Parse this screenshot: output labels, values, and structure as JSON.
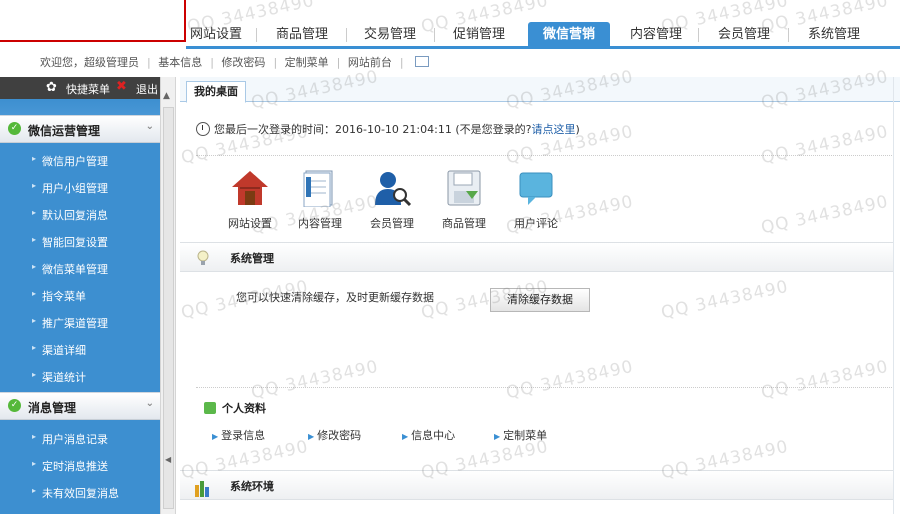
{
  "nav": {
    "tabs": [
      "网站设置",
      "商品管理",
      "交易管理",
      "促销管理",
      "微信营销",
      "内容管理",
      "会员管理",
      "系统管理"
    ],
    "active_index": 4
  },
  "user_bar": {
    "welcome": "欢迎您，超级管理员",
    "links": [
      "基本信息",
      "修改密码",
      "定制菜单",
      "网站前台"
    ]
  },
  "sidebar": {
    "toolbar": {
      "quick_menu": "快捷菜单",
      "exit": "退出"
    },
    "groups": [
      {
        "title": "微信运营管理",
        "items": [
          "微信用户管理",
          "用户小组管理",
          "默认回复消息",
          "智能回复设置",
          "微信菜单管理",
          "指令菜单",
          "推广渠道管理",
          "渠道详细",
          "渠道统计"
        ]
      },
      {
        "title": "消息管理",
        "items": [
          "用户消息记录",
          "定时消息推送",
          "未有效回复消息"
        ]
      }
    ]
  },
  "main": {
    "tab_label": "我的桌面",
    "login_info": {
      "prefix": "您最后一次登录的时间：",
      "time": "2016-10-10 21:04:11",
      "question": "(不是您登录的?",
      "link": "请点这里",
      "close_paren": ")"
    },
    "quick_icons": [
      "网站设置",
      "内容管理",
      "会员管理",
      "商品管理",
      "用户评论"
    ],
    "system_section": {
      "title": "系统管理",
      "cache_text": "您可以快速清除缓存，及时更新缓存数据",
      "cache_button": "清除缓存数据"
    },
    "profile_section": {
      "title": "个人资料",
      "links": [
        "登录信息",
        "修改密码",
        "信息中心",
        "定制菜单"
      ]
    },
    "env_section": {
      "title": "系统环境"
    }
  },
  "watermark": {
    "text": "QQ 34438490"
  },
  "colors": {
    "accent": "#3a8fd3",
    "sidebar_bg": "#3d8fd0",
    "link": "#1f5fa8",
    "check_green": "#55b83a"
  }
}
